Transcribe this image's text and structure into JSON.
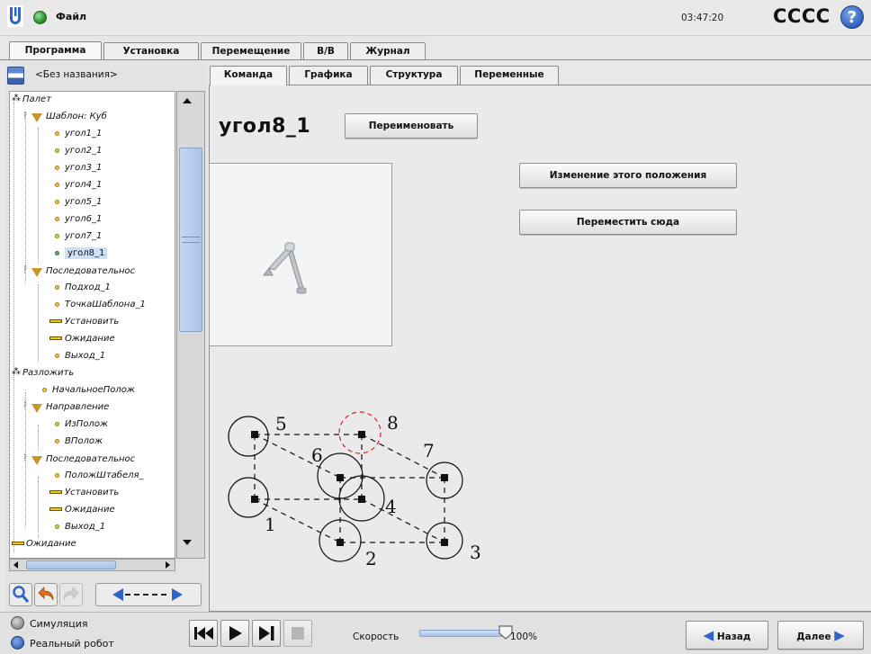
{
  "header": {
    "file_menu": "Файл",
    "clock": "03:47:20",
    "robot_name": "CCCC",
    "help_symbol": "?",
    "status_color": "#2f9a2f"
  },
  "main_tabs": [
    "Программа",
    "Установка",
    "Перемещение",
    "В/В",
    "Журнал"
  ],
  "program": {
    "name": "<Без названия>",
    "tree": [
      {
        "label": "Палет",
        "type": "pallet"
      },
      {
        "label": "Шаблон: Куб",
        "type": "folder"
      },
      {
        "label": "угол1_1",
        "type": "waypoint"
      },
      {
        "label": "угол2_1",
        "type": "waypoint"
      },
      {
        "label": "угол3_1",
        "type": "waypoint"
      },
      {
        "label": "угол4_1",
        "type": "waypoint"
      },
      {
        "label": "угол5_1",
        "type": "waypoint"
      },
      {
        "label": "угол6_1",
        "type": "waypoint"
      },
      {
        "label": "угол7_1",
        "type": "waypoint"
      },
      {
        "label": "угол8_1",
        "type": "waypoint-selected"
      },
      {
        "label": "Последовательнос",
        "type": "folder"
      },
      {
        "label": "Подход_1",
        "type": "waypoint"
      },
      {
        "label": "ТочкаШаблона_1",
        "type": "waypoint"
      },
      {
        "label": "Установить",
        "type": "set"
      },
      {
        "label": "Ожидание",
        "type": "set"
      },
      {
        "label": "Выход_1",
        "type": "waypoint"
      },
      {
        "label": "Разложить",
        "type": "pallet"
      },
      {
        "label": "НачальноеПолож",
        "type": "waypoint"
      },
      {
        "label": "Направление",
        "type": "folder"
      },
      {
        "label": "ИзПолож",
        "type": "waypoint"
      },
      {
        "label": "ВПолож",
        "type": "waypoint"
      },
      {
        "label": "Последовательнос",
        "type": "folder"
      },
      {
        "label": "ПоложШтабеля_",
        "type": "waypoint"
      },
      {
        "label": "Установить",
        "type": "set"
      },
      {
        "label": "Ожидание",
        "type": "set"
      },
      {
        "label": "Выход_1",
        "type": "waypoint"
      },
      {
        "label": "Ожидание",
        "type": "set"
      }
    ]
  },
  "sub_tabs": [
    "Команда",
    "Графика",
    "Структура",
    "Переменные"
  ],
  "command": {
    "waypoint_name": "угол8_1",
    "rename_label": "Переименовать",
    "change_position_label": "Изменение этого положения",
    "move_here_label": "Переместить сюда"
  },
  "pallet_diagram": {
    "labels": [
      "1",
      "2",
      "3",
      "4",
      "5",
      "6",
      "7",
      "8"
    ],
    "highlight_color": "#e02020"
  },
  "footer": {
    "simulation_label": "Симуляция",
    "real_robot_label": "Реальный робот",
    "speed_label": "Скорость",
    "speed_value": "100%",
    "speed_fraction": 1.0,
    "back_label": "Назад",
    "next_label": "Далее"
  }
}
